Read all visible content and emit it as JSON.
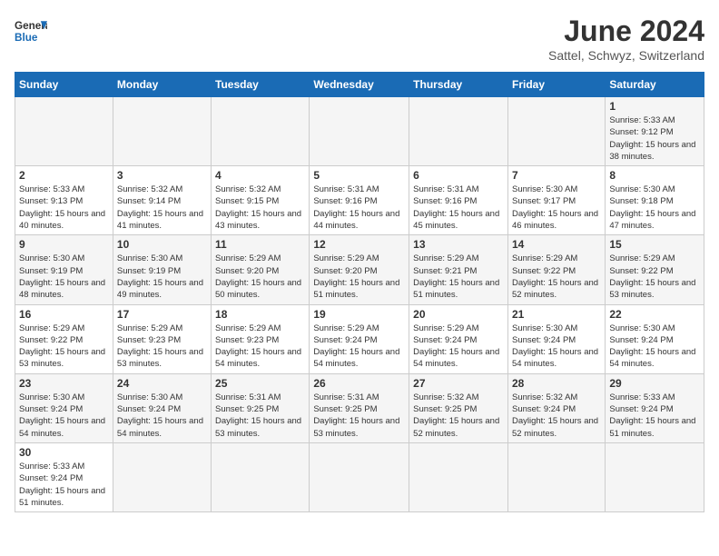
{
  "header": {
    "logo_general": "General",
    "logo_blue": "Blue",
    "month_title": "June 2024",
    "subtitle": "Sattel, Schwyz, Switzerland"
  },
  "days_of_week": [
    "Sunday",
    "Monday",
    "Tuesday",
    "Wednesday",
    "Thursday",
    "Friday",
    "Saturday"
  ],
  "weeks": [
    {
      "days": [
        {
          "num": "",
          "info": ""
        },
        {
          "num": "",
          "info": ""
        },
        {
          "num": "",
          "info": ""
        },
        {
          "num": "",
          "info": ""
        },
        {
          "num": "",
          "info": ""
        },
        {
          "num": "",
          "info": ""
        },
        {
          "num": "1",
          "info": "Sunrise: 5:33 AM\nSunset: 9:12 PM\nDaylight: 15 hours\nand 38 minutes."
        }
      ]
    },
    {
      "days": [
        {
          "num": "2",
          "info": "Sunrise: 5:33 AM\nSunset: 9:13 PM\nDaylight: 15 hours\nand 40 minutes."
        },
        {
          "num": "3",
          "info": "Sunrise: 5:32 AM\nSunset: 9:14 PM\nDaylight: 15 hours\nand 41 minutes."
        },
        {
          "num": "4",
          "info": "Sunrise: 5:32 AM\nSunset: 9:15 PM\nDaylight: 15 hours\nand 43 minutes."
        },
        {
          "num": "5",
          "info": "Sunrise: 5:31 AM\nSunset: 9:16 PM\nDaylight: 15 hours\nand 44 minutes."
        },
        {
          "num": "6",
          "info": "Sunrise: 5:31 AM\nSunset: 9:16 PM\nDaylight: 15 hours\nand 45 minutes."
        },
        {
          "num": "7",
          "info": "Sunrise: 5:30 AM\nSunset: 9:17 PM\nDaylight: 15 hours\nand 46 minutes."
        },
        {
          "num": "8",
          "info": "Sunrise: 5:30 AM\nSunset: 9:18 PM\nDaylight: 15 hours\nand 47 minutes."
        }
      ]
    },
    {
      "days": [
        {
          "num": "9",
          "info": "Sunrise: 5:30 AM\nSunset: 9:19 PM\nDaylight: 15 hours\nand 48 minutes."
        },
        {
          "num": "10",
          "info": "Sunrise: 5:30 AM\nSunset: 9:19 PM\nDaylight: 15 hours\nand 49 minutes."
        },
        {
          "num": "11",
          "info": "Sunrise: 5:29 AM\nSunset: 9:20 PM\nDaylight: 15 hours\nand 50 minutes."
        },
        {
          "num": "12",
          "info": "Sunrise: 5:29 AM\nSunset: 9:20 PM\nDaylight: 15 hours\nand 51 minutes."
        },
        {
          "num": "13",
          "info": "Sunrise: 5:29 AM\nSunset: 9:21 PM\nDaylight: 15 hours\nand 51 minutes."
        },
        {
          "num": "14",
          "info": "Sunrise: 5:29 AM\nSunset: 9:22 PM\nDaylight: 15 hours\nand 52 minutes."
        },
        {
          "num": "15",
          "info": "Sunrise: 5:29 AM\nSunset: 9:22 PM\nDaylight: 15 hours\nand 53 minutes."
        }
      ]
    },
    {
      "days": [
        {
          "num": "16",
          "info": "Sunrise: 5:29 AM\nSunset: 9:22 PM\nDaylight: 15 hours\nand 53 minutes."
        },
        {
          "num": "17",
          "info": "Sunrise: 5:29 AM\nSunset: 9:23 PM\nDaylight: 15 hours\nand 53 minutes."
        },
        {
          "num": "18",
          "info": "Sunrise: 5:29 AM\nSunset: 9:23 PM\nDaylight: 15 hours\nand 54 minutes."
        },
        {
          "num": "19",
          "info": "Sunrise: 5:29 AM\nSunset: 9:24 PM\nDaylight: 15 hours\nand 54 minutes."
        },
        {
          "num": "20",
          "info": "Sunrise: 5:29 AM\nSunset: 9:24 PM\nDaylight: 15 hours\nand 54 minutes."
        },
        {
          "num": "21",
          "info": "Sunrise: 5:30 AM\nSunset: 9:24 PM\nDaylight: 15 hours\nand 54 minutes."
        },
        {
          "num": "22",
          "info": "Sunrise: 5:30 AM\nSunset: 9:24 PM\nDaylight: 15 hours\nand 54 minutes."
        }
      ]
    },
    {
      "days": [
        {
          "num": "23",
          "info": "Sunrise: 5:30 AM\nSunset: 9:24 PM\nDaylight: 15 hours\nand 54 minutes."
        },
        {
          "num": "24",
          "info": "Sunrise: 5:30 AM\nSunset: 9:24 PM\nDaylight: 15 hours\nand 54 minutes."
        },
        {
          "num": "25",
          "info": "Sunrise: 5:31 AM\nSunset: 9:25 PM\nDaylight: 15 hours\nand 53 minutes."
        },
        {
          "num": "26",
          "info": "Sunrise: 5:31 AM\nSunset: 9:25 PM\nDaylight: 15 hours\nand 53 minutes."
        },
        {
          "num": "27",
          "info": "Sunrise: 5:32 AM\nSunset: 9:25 PM\nDaylight: 15 hours\nand 52 minutes."
        },
        {
          "num": "28",
          "info": "Sunrise: 5:32 AM\nSunset: 9:24 PM\nDaylight: 15 hours\nand 52 minutes."
        },
        {
          "num": "29",
          "info": "Sunrise: 5:33 AM\nSunset: 9:24 PM\nDaylight: 15 hours\nand 51 minutes."
        }
      ]
    },
    {
      "days": [
        {
          "num": "30",
          "info": "Sunrise: 5:33 AM\nSunset: 9:24 PM\nDaylight: 15 hours\nand 51 minutes."
        },
        {
          "num": "",
          "info": ""
        },
        {
          "num": "",
          "info": ""
        },
        {
          "num": "",
          "info": ""
        },
        {
          "num": "",
          "info": ""
        },
        {
          "num": "",
          "info": ""
        },
        {
          "num": "",
          "info": ""
        }
      ]
    }
  ]
}
